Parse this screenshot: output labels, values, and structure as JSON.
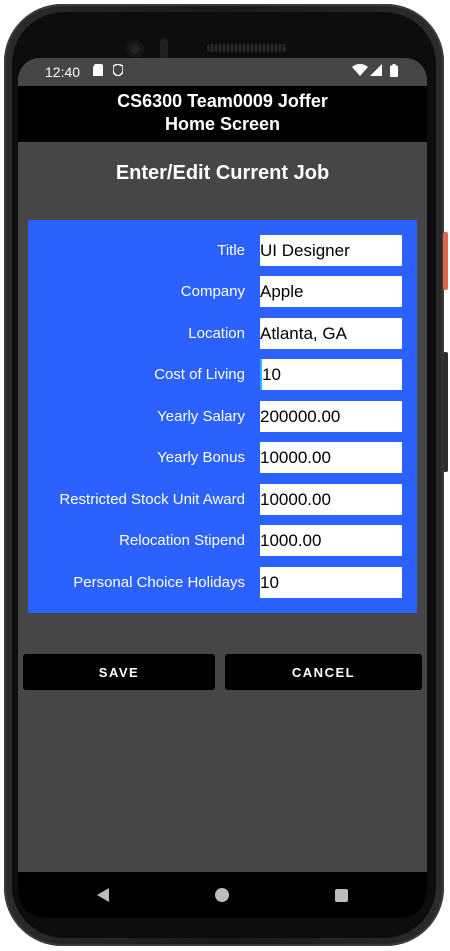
{
  "status_bar": {
    "time": "12:40",
    "icons": [
      "sd-card-icon",
      "shield-icon",
      "wifi-icon",
      "signal-icon",
      "battery-icon"
    ]
  },
  "app_bar": {
    "line1": "CS6300 Team0009 Joffer",
    "line2": "Home Screen"
  },
  "heading": "Enter/Edit Current Job",
  "form": {
    "fields": [
      {
        "label": "Title",
        "value": "UI Designer"
      },
      {
        "label": "Company",
        "value": "Apple"
      },
      {
        "label": "Location",
        "value": "Atlanta, GA"
      },
      {
        "label": "Cost of Living",
        "value": "10"
      },
      {
        "label": "Yearly Salary",
        "value": "200000.00"
      },
      {
        "label": "Yearly Bonus",
        "value": "10000.00"
      },
      {
        "label": "Restricted Stock Unit Award",
        "value": "10000.00"
      },
      {
        "label": "Relocation Stipend",
        "value": "1000.00"
      },
      {
        "label": "Personal Choice Holidays",
        "value": "10"
      }
    ]
  },
  "buttons": {
    "save": "SAVE",
    "cancel": "CANCEL"
  },
  "colors": {
    "panel": "#2a61ff",
    "background": "#464646",
    "app_bar": "#000000"
  },
  "nav_bar": {
    "icons": [
      "back-icon",
      "home-icon",
      "recents-icon"
    ]
  }
}
